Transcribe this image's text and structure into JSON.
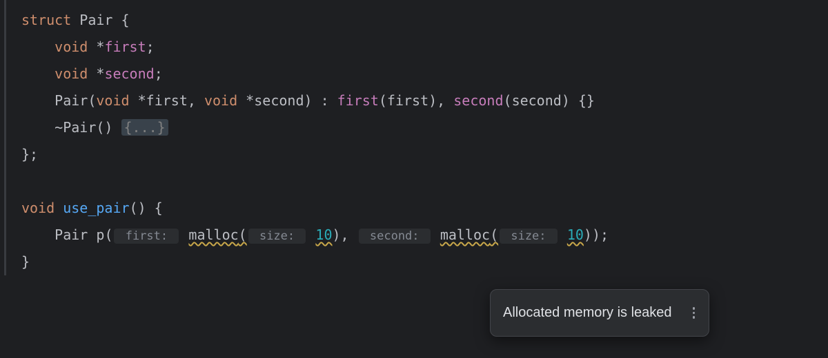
{
  "code": {
    "l1": {
      "kw": "struct",
      "name": "Pair",
      "brace": " {"
    },
    "l2": {
      "indent": "    ",
      "type": "void",
      "star": " *",
      "field": "first",
      "semi": ";"
    },
    "l3": {
      "indent": "    ",
      "type": "void",
      "star": " *",
      "field": "second",
      "semi": ";"
    },
    "l4": {
      "indent": "    ",
      "ctor": "Pair",
      "open": "(",
      "p1t": "void",
      "p1s": " *",
      "p1n": "first",
      "comma1": ", ",
      "p2t": "void",
      "p2s": " *",
      "p2n": "second",
      "close": ") : ",
      "i1f": "first",
      "i1o": "(",
      "i1a": "first",
      "i1c": "), ",
      "i2f": "second",
      "i2o": "(",
      "i2a": "second",
      "i2c": ") {}"
    },
    "l5": {
      "indent": "    ",
      "tilde": "~",
      "dtor": "Pair",
      "parens": "() ",
      "fold": "{...}"
    },
    "l6": {
      "close": "};"
    },
    "l8": {
      "type": "void",
      "sp": " ",
      "fn": "use_pair",
      "parens": "() {"
    },
    "l9": {
      "indent": "    ",
      "pairT": "Pair",
      "sp": " ",
      "var": "p",
      "open": "(",
      "hint1": " first: ",
      "m1": "malloc",
      "m1o": "(",
      "hint1b": " size: ",
      "n1": "10",
      "m1c": "), ",
      "hint2": " second: ",
      "m2": "malloc",
      "m2o": "(",
      "hint2b": " size: ",
      "n2": "10",
      "m2c": "));"
    },
    "l10": {
      "close": "}"
    }
  },
  "tooltip": {
    "text": "Allocated memory is leaked"
  }
}
